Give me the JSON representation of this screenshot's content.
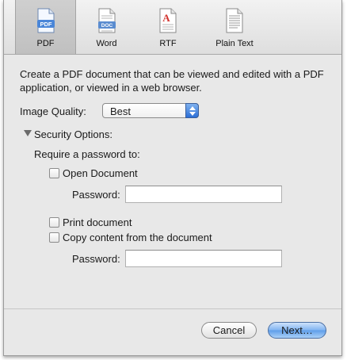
{
  "toolbar": {
    "items": [
      {
        "label": "PDF",
        "icon": "pdf-icon",
        "selected": true,
        "badge": "PDF"
      },
      {
        "label": "Word",
        "icon": "word-icon",
        "selected": false,
        "badge": "DOC"
      },
      {
        "label": "RTF",
        "icon": "rtf-icon",
        "selected": false,
        "badge": "A"
      },
      {
        "label": "Plain Text",
        "icon": "plain-text-icon",
        "selected": false,
        "badge": ""
      }
    ]
  },
  "main": {
    "description": "Create a PDF document that can be viewed and edited with a PDF application, or viewed in a web browser.",
    "image_quality": {
      "label": "Image Quality:",
      "value": "Best"
    },
    "security": {
      "label": "Security Options:",
      "expanded": true,
      "require_label": "Require a password to:",
      "open_document": {
        "label": "Open Document",
        "checked": false,
        "password_label": "Password:",
        "password_value": ""
      },
      "print_document": {
        "label": "Print document",
        "checked": false
      },
      "copy_content": {
        "label": "Copy content from the document",
        "checked": false,
        "password_label": "Password:",
        "password_value": ""
      }
    }
  },
  "footer": {
    "cancel_label": "Cancel",
    "next_label": "Next…"
  },
  "colors": {
    "accent": "#3d7fe0",
    "background": "#e8e8e8"
  }
}
